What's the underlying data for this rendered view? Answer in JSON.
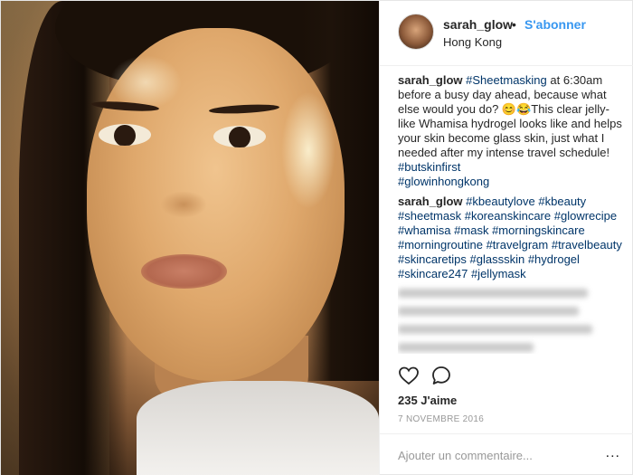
{
  "post": {
    "username": "sarah_glow",
    "separator": "•",
    "follow_label": "S'abonner",
    "location": "Hong Kong",
    "caption": {
      "username": "sarah_glow",
      "hashtag_1": "#Sheetmasking",
      "text_1": " at 6:30am before a busy day ahead, because what else would you do? ",
      "emoji": "😊😂",
      "text_2": "This clear jelly-like Whamisa hydrogel looks like and helps your skin become glass skin, just what I needed after my intense travel schedule! ",
      "hashtag_2": "#butskinfirst",
      "hashtag_3": "#glowinhongkong"
    },
    "comment": {
      "username": "sarah_glow",
      "hashtags": [
        "#kbeautylove",
        "#kbeauty",
        "#sheetmask",
        "#koreanskincare",
        "#glowrecipe",
        "#whamisa",
        "#mask",
        "#morningskincare",
        "#morningroutine",
        "#travelgram",
        "#travelbeauty",
        "#skincaretips",
        "#glassskin",
        "#hydrogel",
        "#skincare247",
        "#jellymask"
      ]
    },
    "likes": "235 J'aime",
    "date": "7 NOVEMBRE 2016",
    "add_comment_placeholder": "Ajouter un commentaire...",
    "more_label": "...",
    "icons": {
      "like": "heart-icon",
      "comment": "speech-bubble-icon",
      "more": "more-options-icon"
    },
    "colors": {
      "link_blue": "#3897f0",
      "hashtag": "#003569",
      "muted": "#999999"
    }
  }
}
